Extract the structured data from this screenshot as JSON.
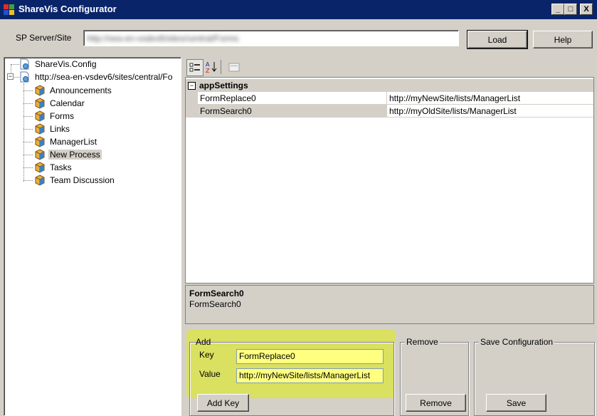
{
  "window": {
    "title": "ShareVis Configurator",
    "controls": {
      "minimize": "_",
      "maximize": "□",
      "close": "X"
    }
  },
  "server": {
    "label": "SP Server/Site",
    "value": "http://sea-en-vsdev6/sites/central/Forms",
    "load_label": "Load",
    "help_label": "Help"
  },
  "tree": {
    "root": "ShareVis.Config",
    "site": "http://sea-en-vsdev6/sites/central/Fo",
    "items": [
      {
        "label": "Announcements"
      },
      {
        "label": "Calendar"
      },
      {
        "label": "Forms"
      },
      {
        "label": "Links"
      },
      {
        "label": "ManagerList"
      },
      {
        "label": "New Process"
      },
      {
        "label": "Tasks"
      },
      {
        "label": "Team Discussion"
      }
    ],
    "selected": "New Process"
  },
  "grid": {
    "category": "appSettings",
    "rows": [
      {
        "key": "FormReplace0",
        "value": "http://myNewSite/lists/ManagerList"
      },
      {
        "key": "FormSearch0",
        "value": "http://myOldSite/lists/ManagerList"
      }
    ],
    "desc_title": "FormSearch0",
    "desc_text": "FormSearch0"
  },
  "add": {
    "legend": "Add",
    "key_label": "Key",
    "key_value": "FormReplace0",
    "value_label": "Value",
    "value_value": "http://myNewSite/lists/ManagerList",
    "button": "Add Key"
  },
  "remove": {
    "legend": "Remove",
    "button": "Remove"
  },
  "save": {
    "legend": "Save Configuration",
    "button": "Save"
  },
  "colors": {
    "titlebar": "#0a246a",
    "highlight": "#dce63c",
    "field": "#ffff80"
  }
}
